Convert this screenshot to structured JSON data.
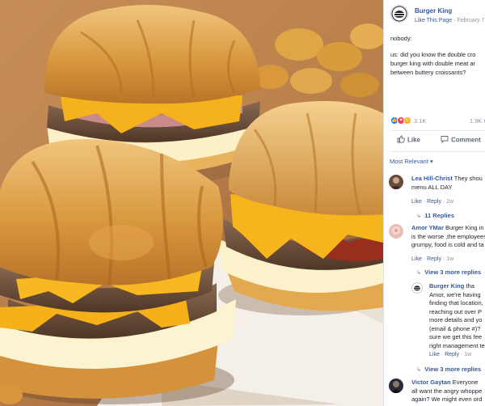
{
  "post": {
    "page_name": "Burger King",
    "like_link": "Like This Page",
    "separator": "·",
    "date": "February 7",
    "body_lines": [
      "nobody:",
      "us: did you know the double cro",
      "burger king with double meat ar",
      "between buttery croissants?"
    ],
    "reaction_count": "3.1K",
    "comment_count": "1.9K C",
    "actions": {
      "like": "Like",
      "comment": "Comment"
    },
    "sort_label": "Most Relevant",
    "sort_caret": "▾"
  },
  "comments": [
    {
      "author": "Lea Hill-Christ",
      "text_lines": [
        "They shou",
        "menu ALL DAY"
      ],
      "actions": [
        "Like",
        "Reply",
        "2w"
      ],
      "replies": "11 Replies",
      "avatar_color": "#6b4a3a"
    },
    {
      "author": "Amor YMar",
      "text_lines": [
        "Burger King in",
        "is the worse ,the employees",
        "grumpy, food is cold and ta"
      ],
      "actions": [
        "Like",
        "Reply",
        "1w"
      ],
      "replies": "View 3 more replies",
      "avatar_color": "#e8bfb8"
    },
    {
      "author": "Burger King",
      "text_lines": [
        "tha",
        "Amor, we're having",
        "finding that location,",
        "reaching out over P",
        "more details and yo",
        "(email & phone #)?",
        "sure we get this fee",
        "right management te"
      ],
      "actions": [
        "Like",
        "Reply",
        "1w"
      ],
      "replies": "View 3 more replies"
    },
    {
      "author": "Victor Gaytan",
      "text_lines": [
        "Everyone",
        "all want the angry whoppe",
        "again? We might even ord"
      ],
      "avatar_color": "#2a2a3a"
    }
  ],
  "colors": {
    "link_blue": "#365899",
    "meta_gray": "#90949c",
    "like_blue": "#1877f2",
    "love_red": "#f33e58",
    "haha_yellow": "#f7b125"
  }
}
